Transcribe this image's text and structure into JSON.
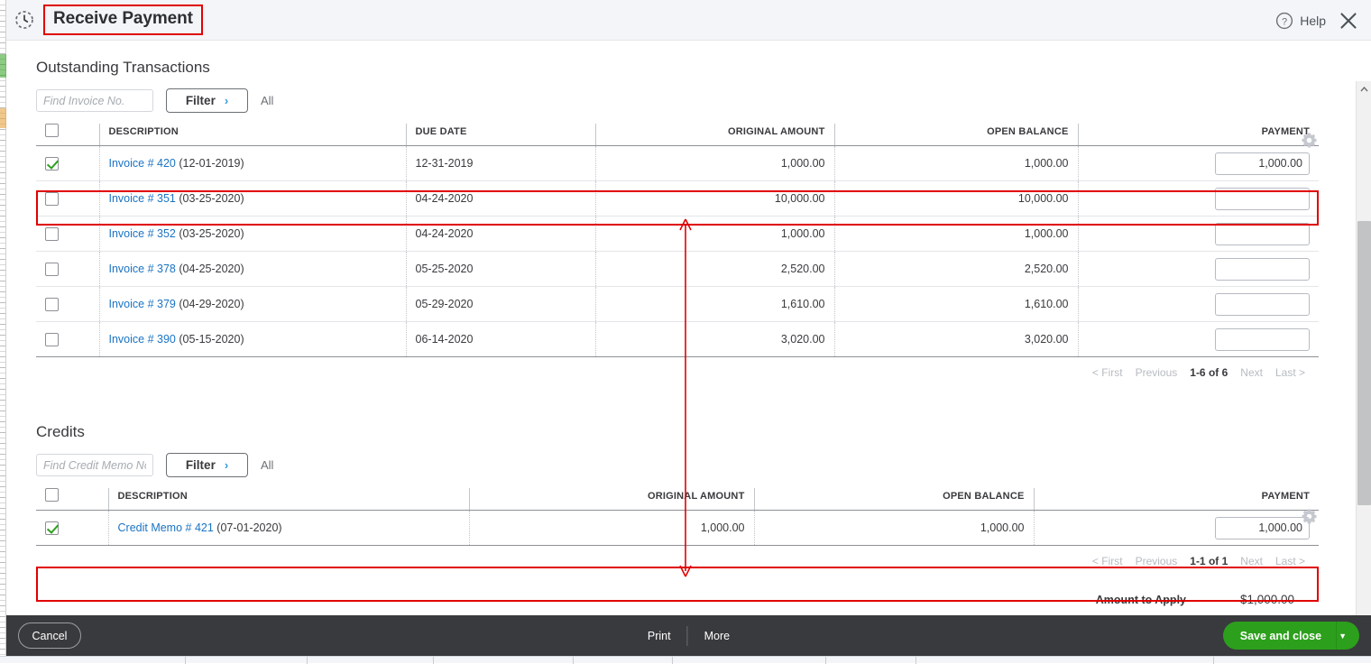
{
  "header": {
    "icon": "recent-history-icon",
    "title": "Receive Payment",
    "help_label": "Help",
    "help_icon": "question-circle-icon",
    "close_icon": "close-x-icon"
  },
  "outstanding": {
    "section_title": "Outstanding Transactions",
    "find_placeholder": "Find Invoice No.",
    "find_value": "",
    "filter_label": "Filter",
    "filter_chevron": "›",
    "all_label": "All",
    "gear_icon": "gear-icon",
    "columns": [
      "DESCRIPTION",
      "DUE DATE",
      "ORIGINAL AMOUNT",
      "OPEN BALANCE",
      "PAYMENT"
    ],
    "rows": [
      {
        "checked": true,
        "link": "Invoice # 420",
        "date_suffix": "(12-01-2019)",
        "due_date": "12-31-2019",
        "original_amount": "1,000.00",
        "open_balance": "1,000.00",
        "payment": "1,000.00"
      },
      {
        "checked": false,
        "link": "Invoice # 351",
        "date_suffix": "(03-25-2020)",
        "due_date": "04-24-2020",
        "original_amount": "10,000.00",
        "open_balance": "10,000.00",
        "payment": ""
      },
      {
        "checked": false,
        "link": "Invoice # 352",
        "date_suffix": "(03-25-2020)",
        "due_date": "04-24-2020",
        "original_amount": "1,000.00",
        "open_balance": "1,000.00",
        "payment": ""
      },
      {
        "checked": false,
        "link": "Invoice # 378",
        "date_suffix": "(04-25-2020)",
        "due_date": "05-25-2020",
        "original_amount": "2,520.00",
        "open_balance": "2,520.00",
        "payment": ""
      },
      {
        "checked": false,
        "link": "Invoice # 379",
        "date_suffix": "(04-29-2020)",
        "due_date": "05-29-2020",
        "original_amount": "1,610.00",
        "open_balance": "1,610.00",
        "payment": ""
      },
      {
        "checked": false,
        "link": "Invoice # 390",
        "date_suffix": "(05-15-2020)",
        "due_date": "06-14-2020",
        "original_amount": "3,020.00",
        "open_balance": "3,020.00",
        "payment": ""
      }
    ],
    "pager": {
      "first": "< First",
      "previous": "Previous",
      "range": "1-6 of 6",
      "next": "Next",
      "last": "Last >"
    }
  },
  "credits": {
    "section_title": "Credits",
    "find_placeholder": "Find Credit Memo No.",
    "find_value": "",
    "filter_label": "Filter",
    "filter_chevron": "›",
    "all_label": "All",
    "gear_icon": "gear-icon",
    "columns": [
      "DESCRIPTION",
      "ORIGINAL AMOUNT",
      "OPEN BALANCE",
      "PAYMENT"
    ],
    "rows": [
      {
        "checked": true,
        "link": "Credit Memo # 421",
        "date_suffix": "(07-01-2020)",
        "original_amount": "1,000.00",
        "open_balance": "1,000.00",
        "payment": "1,000.00"
      }
    ],
    "pager": {
      "first": "< First",
      "previous": "Previous",
      "range": "1-1 of 1",
      "next": "Next",
      "last": "Last >"
    }
  },
  "totals": {
    "amount_to_apply_label": "Amount to Apply",
    "amount_to_apply_value": "$1,000.00"
  },
  "footer": {
    "cancel_label": "Cancel",
    "print_label": "Print",
    "more_label": "More",
    "save_label": "Save and close",
    "save_caret": "▼"
  },
  "annotations": {
    "highlight_color": "#e00000",
    "arrow_color": "#e00000",
    "arrow_note": "double-headed vertical arrow linking invoice row to credit memo row"
  },
  "colors": {
    "accent_green": "#2ca01c",
    "link_blue": "#1a73c4",
    "footer_dark": "#393a3d",
    "header_bg": "#f4f5f8"
  }
}
